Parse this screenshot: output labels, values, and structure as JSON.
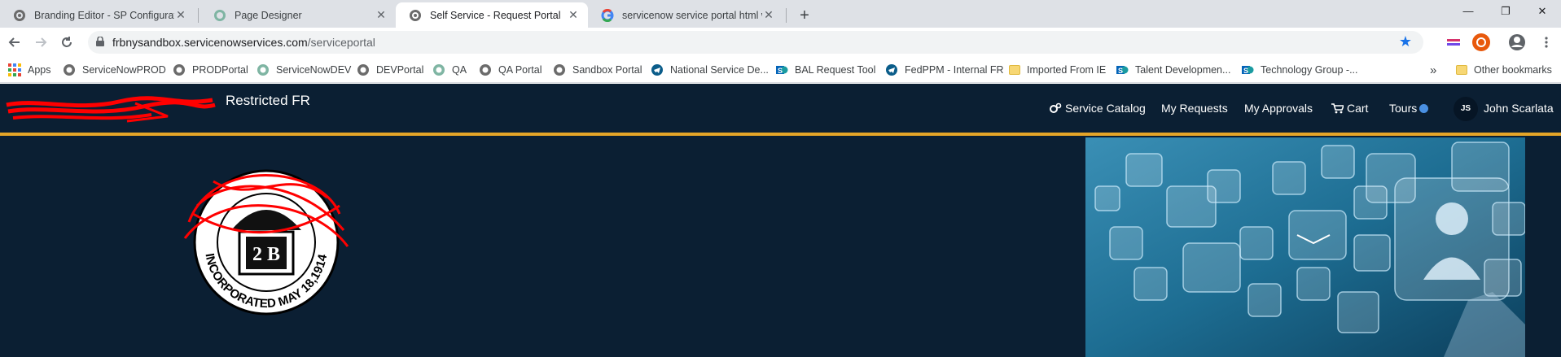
{
  "browser": {
    "tabs": [
      {
        "title": "Branding Editor - SP Configuratio",
        "active": false,
        "favicon": "servicenow-favicon-icon"
      },
      {
        "title": "Page Designer",
        "active": false,
        "favicon": "servicenow-green-favicon-icon"
      },
      {
        "title": "Self Service - Request Portal",
        "active": true,
        "favicon": "servicenow-favicon-icon"
      },
      {
        "title": "servicenow service portal html w",
        "active": false,
        "favicon": "google-icon"
      }
    ],
    "close_glyph": "✕",
    "new_tab_glyph": "+",
    "window_controls": {
      "minimize": "—",
      "restore": "❐",
      "close": "✕"
    },
    "url": {
      "host": "frbnysandbox.servicenowservices.com",
      "path": "/serviceportal"
    },
    "bookmarks": [
      {
        "label": "Apps",
        "icon": "apps-grid-icon"
      },
      {
        "label": "ServiceNowPROD",
        "icon": "servicenow-favicon-icon"
      },
      {
        "label": "PRODPortal",
        "icon": "servicenow-favicon-icon"
      },
      {
        "label": "ServiceNowDEV",
        "icon": "servicenow-green-favicon-icon"
      },
      {
        "label": "DEVPortal",
        "icon": "servicenow-favicon-icon"
      },
      {
        "label": "QA",
        "icon": "servicenow-green-favicon-icon"
      },
      {
        "label": "QA Portal",
        "icon": "servicenow-favicon-icon"
      },
      {
        "label": "Sandbox Portal",
        "icon": "servicenow-favicon-icon"
      },
      {
        "label": "National Service De...",
        "icon": "telegram-style-icon"
      },
      {
        "label": "BAL Request Tool",
        "icon": "sharepoint-icon"
      },
      {
        "label": "FedPPM - Internal FR",
        "icon": "telegram-style-icon"
      },
      {
        "label": "Imported From IE",
        "icon": "folder-icon"
      },
      {
        "label": "Talent Developmen...",
        "icon": "sharepoint-icon"
      },
      {
        "label": "Technology Group -...",
        "icon": "sharepoint-icon"
      }
    ],
    "bookmarks_overflow": "»",
    "other_bookmarks": "Other bookmarks"
  },
  "portal": {
    "brand_name": "Restricted FR",
    "nav": {
      "service_catalog": "Service Catalog",
      "my_requests": "My Requests",
      "my_approvals": "My Approvals",
      "cart": "Cart",
      "tours": "Tours"
    },
    "user": {
      "initials": "JS",
      "name": "John Scarlata"
    },
    "seal": {
      "top_text": "INCORPORATED MAY 18,1914",
      "center_text": "2 B"
    }
  },
  "colors": {
    "header_bg": "#0b1f33",
    "accent_gold": "#e5a528",
    "tours_dot": "#4a90e2",
    "redaction": "#ff0000"
  }
}
